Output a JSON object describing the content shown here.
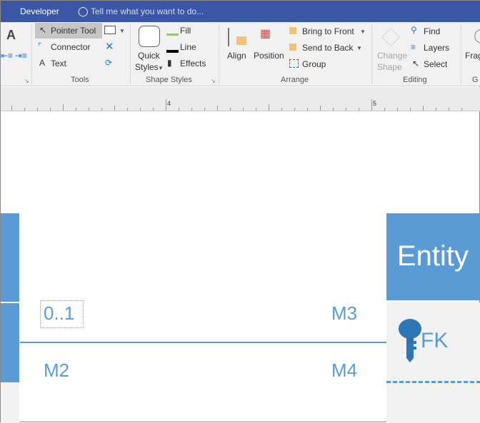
{
  "titlebar": {
    "tab": "Developer",
    "tell_me": "Tell me what you want to do..."
  },
  "ribbon": {
    "tools": {
      "pointer": "Pointer Tool",
      "connector": "Connector",
      "text": "Text",
      "label": "Tools"
    },
    "shape_styles": {
      "quick1": "Quick",
      "quick2": "Styles",
      "fill": "Fill",
      "line": "Line",
      "effects": "Effects",
      "label": "Shape Styles"
    },
    "arrange": {
      "align": "Align",
      "position": "Position",
      "bring_front": "Bring to Front",
      "send_back": "Send to Back",
      "group": "Group",
      "label": "Arrange"
    },
    "editing": {
      "change1": "Change",
      "change2": "Shape",
      "find": "Find",
      "layers": "Layers",
      "select": "Select",
      "label": "Editing"
    },
    "next": {
      "frag": "Frag",
      "label": "G"
    }
  },
  "ruler": {
    "marks": [
      "4",
      "5"
    ]
  },
  "diagram": {
    "entity_title": "Entity",
    "fk": "FK",
    "label_01": "0..1",
    "m2": "M2",
    "m3": "M3",
    "m4": "M4",
    "accent": "#5b9bd5",
    "key_color": "#2e75b6"
  }
}
